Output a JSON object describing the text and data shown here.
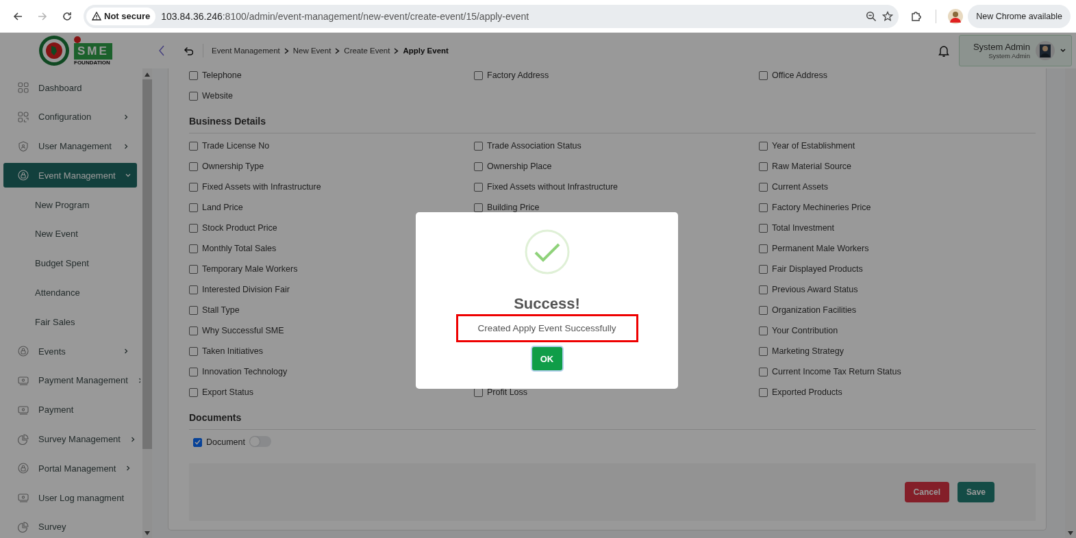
{
  "browser": {
    "forward_disabled": true,
    "security": "Not secure",
    "url_host": "103.84.36.246",
    "url_path": ":8100/admin/event-management/new-event/create-event/15/apply-event",
    "update_label": "New Chrome available"
  },
  "logo": {
    "text": "SME",
    "subtext": "FOUNDATION"
  },
  "sidebar": {
    "items": [
      {
        "label": "Dashboard",
        "selected": false
      },
      {
        "label": "Configuration",
        "expanded": false,
        "selected": false
      },
      {
        "label": "User Management",
        "expanded": false,
        "selected": false
      },
      {
        "label": "Event Management",
        "expanded": true,
        "selected": true,
        "children": [
          {
            "label": "New Program"
          },
          {
            "label": "New Event"
          },
          {
            "label": "Budget Spent"
          },
          {
            "label": "Attendance"
          },
          {
            "label": "Fair Sales"
          }
        ]
      },
      {
        "label": "Events",
        "expanded": false,
        "selected": false
      },
      {
        "label": "Payment Management",
        "expanded": false,
        "selected": false
      },
      {
        "label": "Payment",
        "selected": false
      },
      {
        "label": "Survey Management",
        "expanded": false,
        "selected": false
      },
      {
        "label": "Portal Management",
        "expanded": false,
        "selected": false
      },
      {
        "label": "User Log managment",
        "selected": false
      },
      {
        "label": "Survey",
        "selected": false
      }
    ]
  },
  "header": {
    "breadcrumbs": [
      {
        "label": "Event Management",
        "current": false
      },
      {
        "label": "New Event",
        "current": false
      },
      {
        "label": "Create Event",
        "current": false
      },
      {
        "label": "Apply Event",
        "current": true
      }
    ],
    "user": {
      "name": "System Admin",
      "role": "System Admin"
    }
  },
  "form": {
    "sections": [
      {
        "rows": [
          [
            {
              "label": "Telephone",
              "checked": false
            },
            {
              "label": "Factory Address",
              "checked": false
            },
            {
              "label": "Office Address",
              "checked": false
            }
          ],
          [
            {
              "label": "Website",
              "checked": false
            }
          ]
        ]
      },
      {
        "title": "Business Details",
        "rows": [
          [
            {
              "label": "Trade License No",
              "checked": false
            },
            {
              "label": "Trade Association Status",
              "checked": false
            },
            {
              "label": "Year of Establishment",
              "checked": false
            }
          ],
          [
            {
              "label": "Ownership Type",
              "checked": false
            },
            {
              "label": "Ownership Place",
              "checked": false
            },
            {
              "label": "Raw Material Source",
              "checked": false
            }
          ],
          [
            {
              "label": "Fixed Assets with Infrastructure",
              "checked": false
            },
            {
              "label": "Fixed Assets without Infrastructure",
              "checked": false
            },
            {
              "label": "Current Assets",
              "checked": false
            }
          ],
          [
            {
              "label": "Land Price",
              "checked": false
            },
            {
              "label": "Building Price",
              "checked": false
            },
            {
              "label": "Factory Mechineries Price",
              "checked": false
            }
          ],
          [
            {
              "label": "Stock Product Price",
              "checked": false
            },
            null,
            {
              "label": "Total Investment",
              "checked": false
            }
          ],
          [
            {
              "label": "Monthly Total Sales",
              "checked": false
            },
            null,
            {
              "label": "Permanent Male Workers",
              "checked": false
            }
          ],
          [
            {
              "label": "Temporary Male Workers",
              "checked": false
            },
            null,
            {
              "label": "Fair Displayed Products",
              "checked": false
            }
          ],
          [
            {
              "label": "Interested Division Fair",
              "checked": false
            },
            null,
            {
              "label": "Previous Award Status",
              "checked": false
            }
          ],
          [
            {
              "label": "Stall Type",
              "checked": false
            },
            null,
            {
              "label": "Organization Facilities",
              "checked": false
            }
          ],
          [
            {
              "label": "Why Successful SME",
              "checked": false
            },
            null,
            {
              "label": "Your Contribution",
              "checked": false
            }
          ],
          [
            {
              "label": "Taken Initiatives",
              "checked": false
            },
            null,
            {
              "label": "Marketing Strategy",
              "checked": false
            }
          ],
          [
            {
              "label": "Innovation Technology",
              "checked": false
            },
            null,
            {
              "label": "Current Income Tax Return Status",
              "checked": false
            }
          ],
          [
            {
              "label": "Export Status",
              "checked": false
            },
            {
              "label": "Profit Loss",
              "checked": false
            },
            {
              "label": "Exported Products",
              "checked": false
            }
          ]
        ]
      },
      {
        "title": "Documents",
        "rows": [
          [
            {
              "label": "Document",
              "checked": true,
              "kind": "toggle",
              "on": false
            }
          ]
        ]
      }
    ],
    "buttons": [
      {
        "label": "Cancel",
        "kind": "danger"
      },
      {
        "label": "Save",
        "kind": "primary"
      }
    ]
  },
  "dialog": {
    "title": "Success!",
    "message": "Created Apply Event Successfully",
    "highlighted": true,
    "button": "OK"
  }
}
